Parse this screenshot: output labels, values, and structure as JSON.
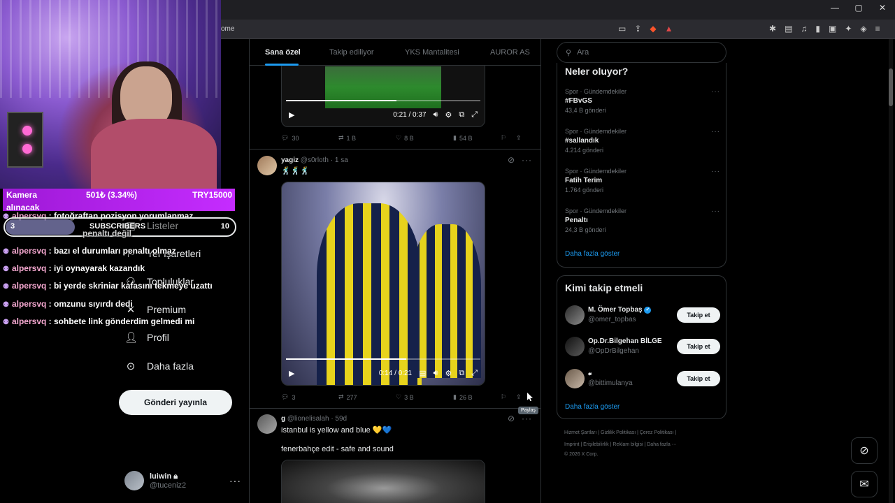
{
  "browser": {
    "url": "ome"
  },
  "tabs": [
    {
      "label": "Sana özel",
      "active": true
    },
    {
      "label": "Takip ediliyor",
      "active": false
    },
    {
      "label": "YKS Mantalitesi",
      "active": false
    },
    {
      "label": "AUROR AS",
      "active": false
    }
  ],
  "nav": {
    "items": [
      {
        "label": "Listeler",
        "icon": "list-icon"
      },
      {
        "label": "Yer işaretleri",
        "icon": "bookmark-icon"
      },
      {
        "label": "Topluluklar",
        "icon": "communities-icon"
      },
      {
        "label": "Premium",
        "icon": "x-logo-icon"
      },
      {
        "label": "Profil",
        "icon": "profile-icon"
      },
      {
        "label": "Daha fazla",
        "icon": "more-circle-icon"
      }
    ],
    "post_button": "Gönderi yayınla",
    "account": {
      "name": "luiwin",
      "handle": "@tuceniz2"
    }
  },
  "tweet1": {
    "video_time": "0:21 / 0:37",
    "video_progress": 0.57,
    "replies": "30",
    "retweets": "1 B",
    "likes": "8 B",
    "views": "54 B"
  },
  "tweet2": {
    "name": "yagiz",
    "handle": "@s0rloth",
    "time": "· 1 sa",
    "text": "🕺🕺🕺",
    "video_time": "0:14 / 0:21",
    "video_progress": 0.62,
    "replies": "3",
    "retweets": "277",
    "likes": "3 B",
    "views": "26 B",
    "share_tooltip": "Paylaş"
  },
  "tweet3": {
    "name": "g",
    "handle": "@lionelisalah",
    "time": "· 59d",
    "text1": "istanbul is yellow and blue 💛💙",
    "text2": "fenerbahçe edit - safe and sound"
  },
  "search": {
    "placeholder": "Ara"
  },
  "trends": {
    "title": "Neler oluyor?",
    "items": [
      {
        "category": "Spor · Gündemdekiler",
        "name": "#FBvGS",
        "count": "43,4 B gönderi"
      },
      {
        "category": "Spor · Gündemdekiler",
        "name": "#sallandık",
        "count": "4.214 gönderi"
      },
      {
        "category": "Spor · Gündemdekiler",
        "name": "Fatih Terim",
        "count": "1.764 gönderi"
      },
      {
        "category": "Spor · Gündemdekiler",
        "name": "Penaltı",
        "count": "24,3 B gönderi"
      }
    ],
    "show_more": "Daha fazla göster"
  },
  "who_to_follow": {
    "title": "Kimi takip etmeli",
    "items": [
      {
        "name": "M. Ömer Topbaş",
        "handle": "@omer_topbas",
        "button": "Takip et",
        "verified": true
      },
      {
        "name": "Op.Dr.Bilgehan BİLGE",
        "handle": "@OpDrBilgehan",
        "button": "Takip et",
        "verified": false
      },
      {
        "name": "𝓿",
        "handle": "@bittimulanya",
        "button": "Takip et",
        "verified": false
      }
    ],
    "show_more": "Daha fazla göster"
  },
  "footer": {
    "line1": "Hizmet Şartları  |  Gizlilik Politikası  |  Çerez Politikası  |",
    "line2": "Imprint  |  Erişilebilirlik  |  Reklam bilgisi  |  Daha fazla ···",
    "line3": "© 2026 X Corp."
  },
  "overlay": {
    "donation": {
      "title_line1": "Kamera",
      "title_line2": "alınacak",
      "amount": "501₺ (3.34%)",
      "goal": "TRY15000"
    },
    "subs": {
      "current": "3",
      "label": "SUBSCRIBERS",
      "goal": "10",
      "progress": 0.3
    },
    "chat": [
      {
        "user": "alpersvq",
        "text": " : fotoğraftan pozisyon yorumlanmaz"
      },
      {
        "user": "",
        "text": "penaltı değil"
      },
      {
        "user": "alpersvq",
        "text": " : bazı el durumları penaltı olmaz"
      },
      {
        "user": "alpersvq",
        "text": " : iyi oynayarak kazandık"
      },
      {
        "user": "alpersvq",
        "text": " : bi yerde skriniar kafasını tekmeye uzattı"
      },
      {
        "user": "alpersvq",
        "text": " : omzunu sıyırdı dedi"
      },
      {
        "user": "alpersvq",
        "text": " : sohbete link gönderdim gelmedi mi"
      }
    ]
  },
  "colors": {
    "accent": "#1d9bf0",
    "donation": "#c52cff",
    "background": "#000000"
  }
}
